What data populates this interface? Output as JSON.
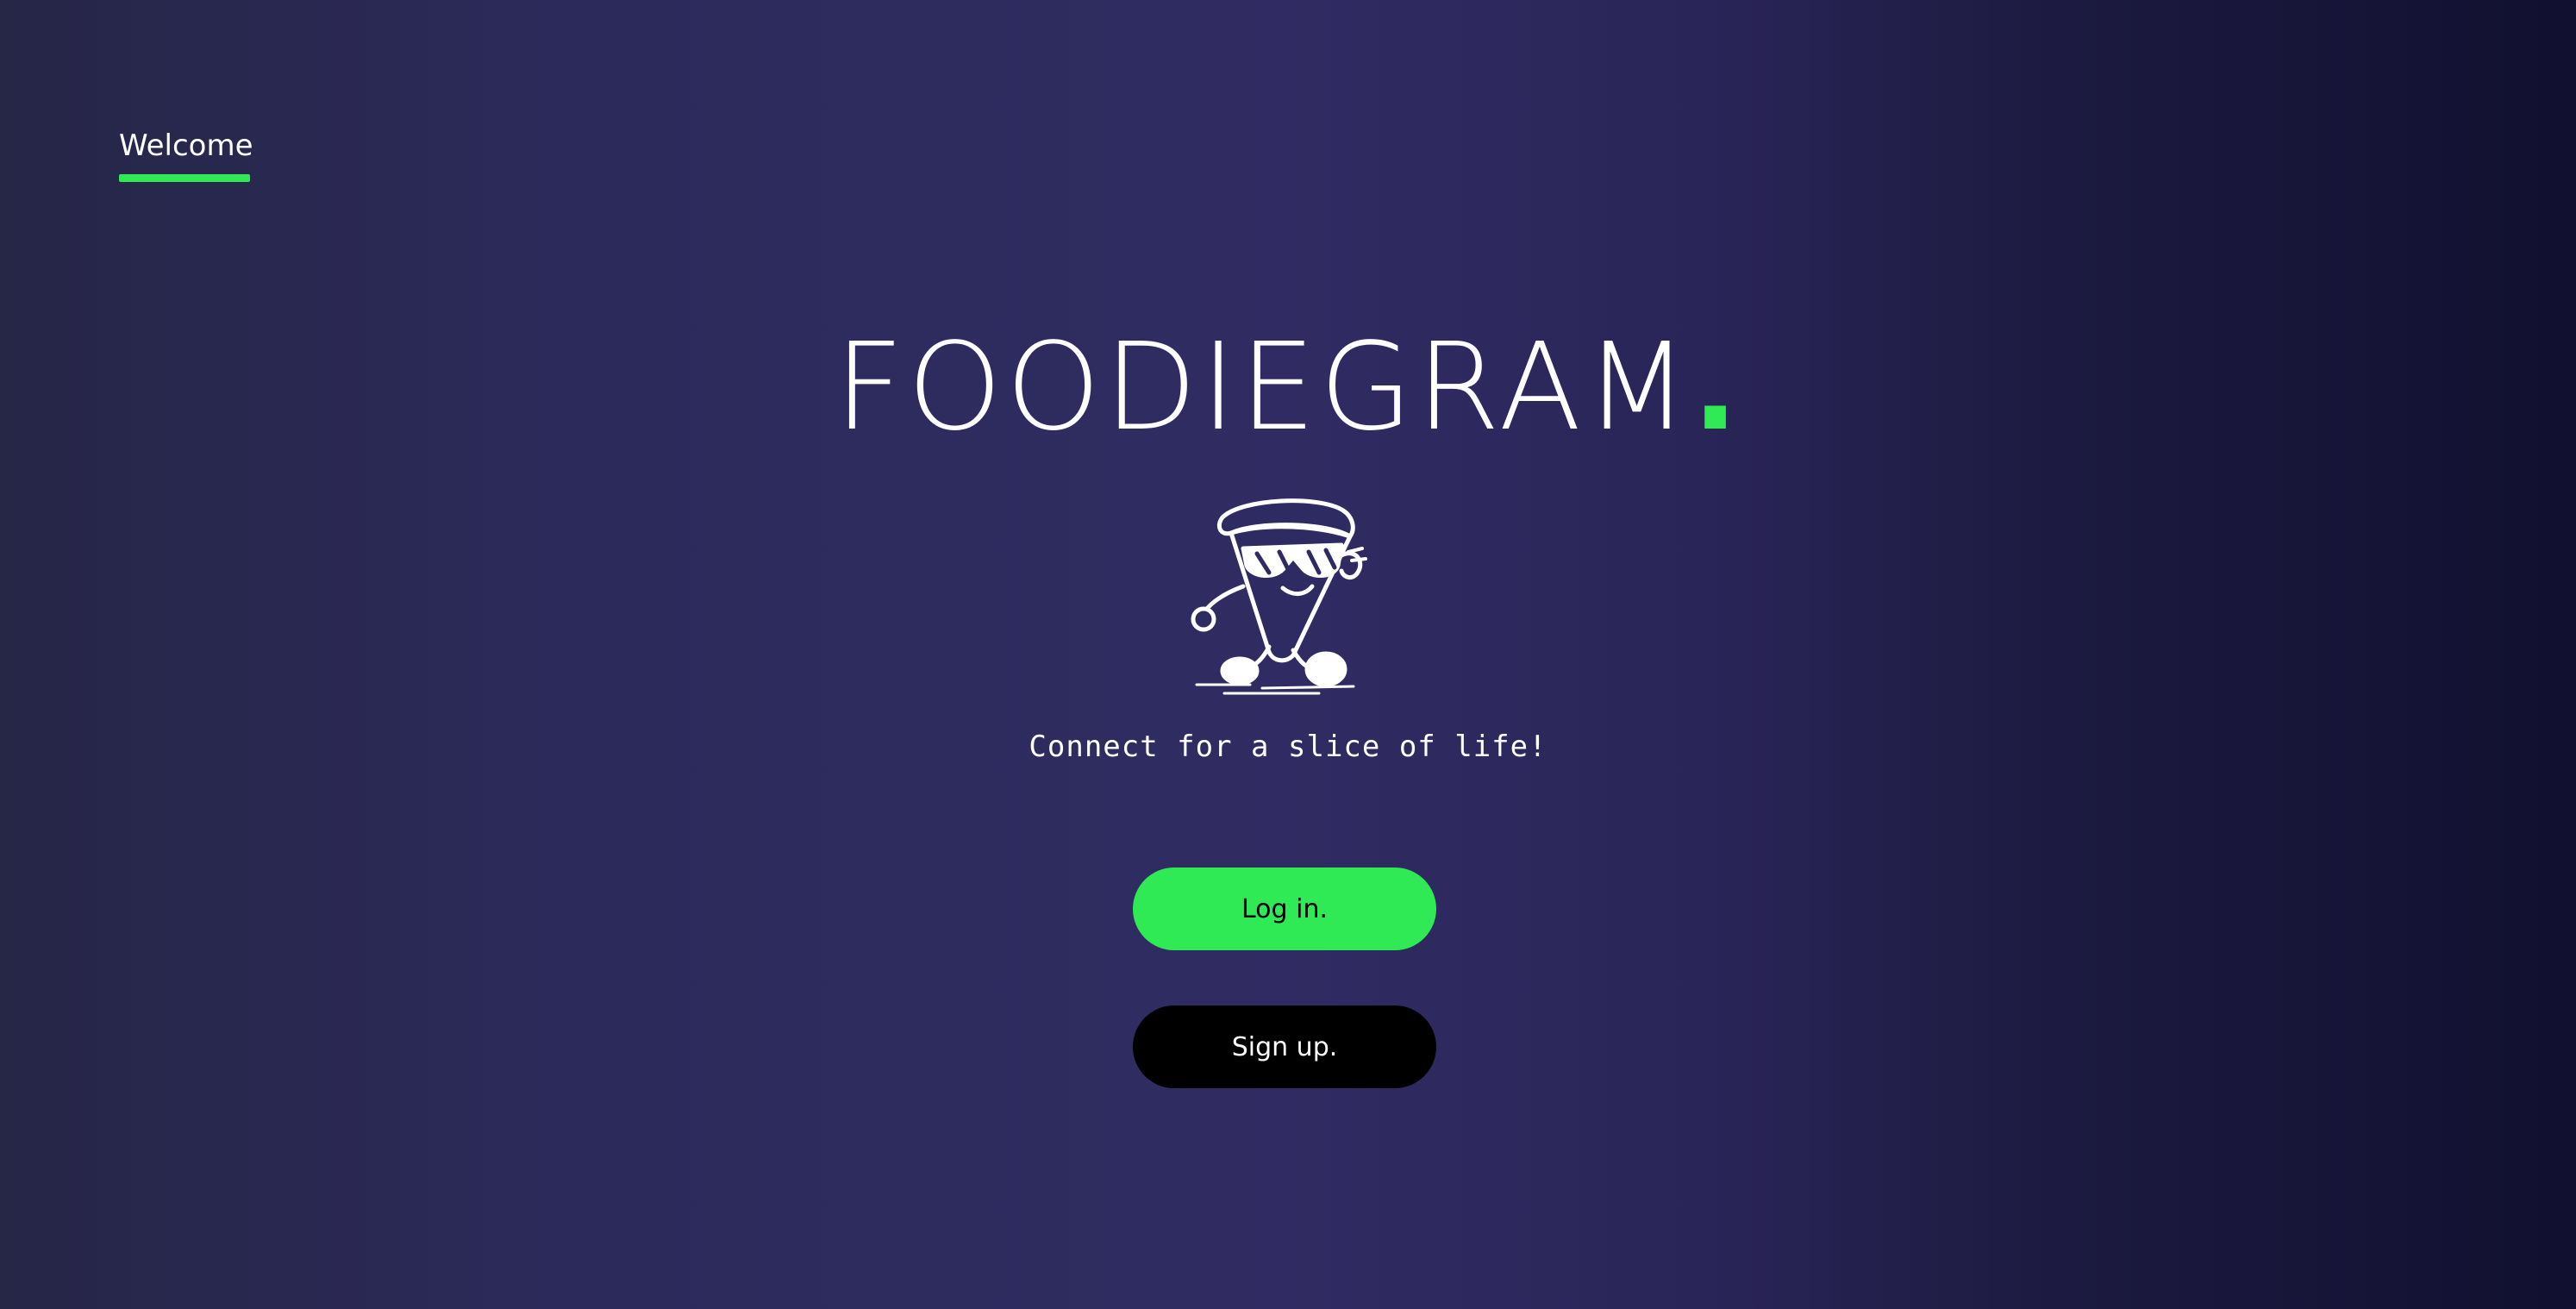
{
  "nav": {
    "tab_label": "Welcome"
  },
  "brand": {
    "name": "FOODIEGRAM",
    "dot": "."
  },
  "hero": {
    "mascot_icon": "pizza-slice-mascot-icon",
    "tagline": "Connect for a slice of life!"
  },
  "actions": {
    "login_label": "Log in.",
    "signup_label": "Sign up."
  },
  "colors": {
    "accent": "#2fe955",
    "text": "#ffffff",
    "signup_bg": "#000000"
  }
}
